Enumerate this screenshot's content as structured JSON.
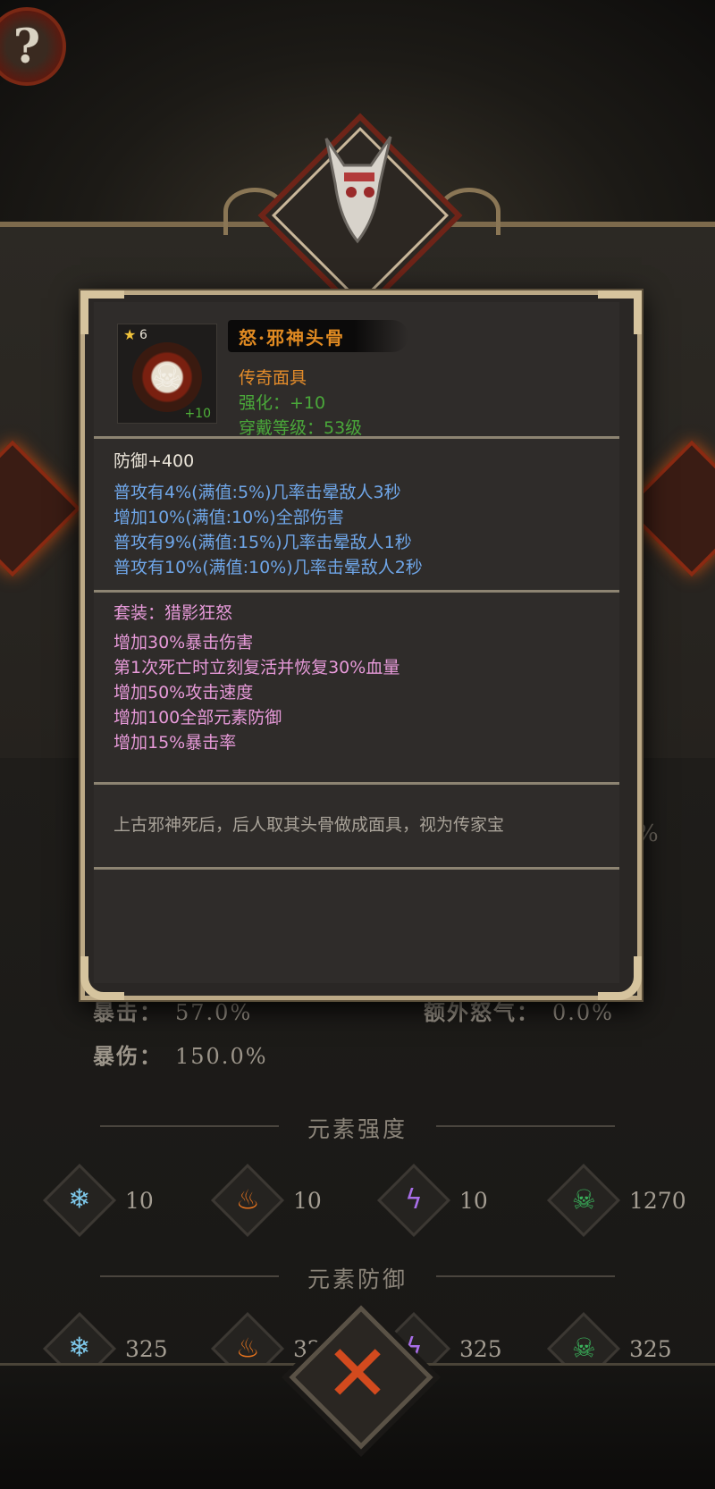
{
  "item": {
    "name": "怒·邪神头骨",
    "star": "6",
    "enhance_badge": "+10",
    "type": "传奇面具",
    "enhance": "强化：+10",
    "wear_level": "穿戴等级：53级"
  },
  "stats": {
    "base": "防御+400",
    "affixes": [
      "普攻有4%(满值:5%)几率击晕敌人3秒",
      "增加10%(满值:10%)全部伤害",
      "普攻有9%(满值:15%)几率击晕敌人1秒",
      "普攻有10%(满值:10%)几率击晕敌人2秒"
    ]
  },
  "set": {
    "title": "套装：猎影狂怒",
    "bonuses": [
      "增加30%暴击伤害",
      "第1次死亡时立刻复活并恢复30%血量",
      "增加50%攻击速度",
      "增加100全部元素防御",
      "增加15%暴击率"
    ]
  },
  "description": "上古邪神死后，后人取其头骨做成面具，视为传家宝",
  "background_stats": {
    "crit_label": "暴击：",
    "crit_value": "57.0%",
    "crit_dmg_label": "暴伤：",
    "crit_dmg_value": "150.0%",
    "extra_rage_label": "额外怒气：",
    "extra_rage_value": "0.0%",
    "pct_peek": "%"
  },
  "element_strength": {
    "title": "元素强度",
    "items": [
      {
        "icon": "ice-icon",
        "value": "10"
      },
      {
        "icon": "fire-icon",
        "value": "10"
      },
      {
        "icon": "lightning-icon",
        "value": "10"
      },
      {
        "icon": "poison-icon",
        "value": "1270"
      }
    ]
  },
  "element_defense": {
    "title": "元素防御",
    "items": [
      {
        "icon": "ice-icon",
        "value": "325"
      },
      {
        "icon": "fire-icon",
        "value": "325"
      },
      {
        "icon": "lightning-icon",
        "value": "325"
      },
      {
        "icon": "poison-icon",
        "value": "325"
      }
    ]
  },
  "controls": {
    "help": "?",
    "close": "✕"
  },
  "colors": {
    "legendary": "#e28b2a",
    "enhance_green": "#4aa83a",
    "affix_blue": "#6fa6e8",
    "set_pink": "#e79ad9",
    "frame_gold": "#bca986"
  }
}
